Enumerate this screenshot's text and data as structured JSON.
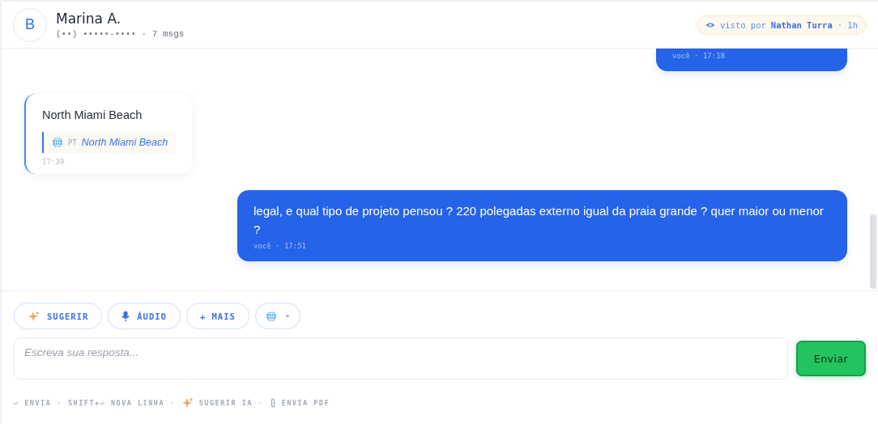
{
  "header": {
    "avatar": "B",
    "name": "Marina A.",
    "subtitle": "(••) •••••-•••• · 7 msgs",
    "seen": {
      "prefix": "visto por",
      "who": "Nathan Turra",
      "suffix": "· 1h"
    }
  },
  "messages": [
    {
      "kind": "outgoing",
      "meta": "você · 17:18"
    },
    {
      "kind": "incoming",
      "text": "North Miami Beach",
      "translation": {
        "lang": "PT",
        "text": "North Miami Beach"
      },
      "meta": "17:39"
    },
    {
      "kind": "outgoing",
      "text": "legal, e qual tipo de projeto pensou ? 220 polegadas externo igual da praia grande ? quer maior ou menor ?",
      "meta": "você · 17:51"
    }
  ],
  "actions": [
    {
      "kind": "suggest",
      "label": "SUGERIR"
    },
    {
      "kind": "audio",
      "label": "ÁUDIO"
    },
    {
      "kind": "more",
      "label": "+ MAIS"
    },
    {
      "kind": "language"
    }
  ],
  "composer": {
    "placeholder": "Escreva sua resposta...",
    "send": "Enviar"
  },
  "hint_separator": "·",
  "hints": [
    {
      "kind": "text",
      "label": "⏎ ENVIA"
    },
    {
      "kind": "text",
      "label": "SHIFT+⏎ NOVA LINHA"
    },
    {
      "kind": "sparkle",
      "label": "SUGERIR IA"
    },
    {
      "kind": "clip",
      "label": "ENVIA PDF"
    }
  ]
}
